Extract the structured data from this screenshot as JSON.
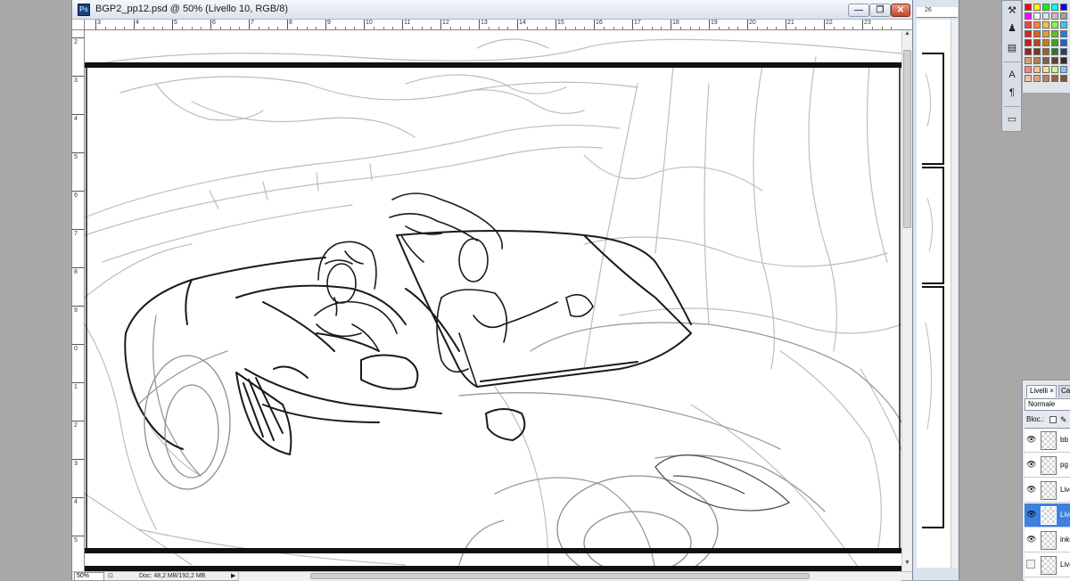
{
  "document": {
    "title": "BGP2_pp12.psd @ 50% (Livello 10, RGB/8)",
    "app_icon": "photoshop-file-icon",
    "zoom": "50%",
    "doc_size": "Doc: 48,2 MB/192,2 MB",
    "ruler_top_labels": [
      "3",
      "4",
      "5",
      "6",
      "7",
      "8",
      "9",
      "10",
      "11",
      "12",
      "13",
      "14",
      "15",
      "16",
      "17",
      "18",
      "19",
      "20",
      "21",
      "22",
      "23"
    ],
    "ruler_left_labels": [
      "2",
      "3",
      "4",
      "5",
      "6",
      "7",
      "8",
      "9",
      "0",
      "1",
      "2",
      "3",
      "4",
      "5"
    ]
  },
  "window_controls": {
    "minimize_glyph": "—",
    "maximize_glyph": "❐",
    "close_glyph": "✕"
  },
  "second_document": {
    "ruler_label": "26"
  },
  "tools": [
    {
      "icon": "hammer-tool-icon",
      "glyph": "⚒"
    },
    {
      "icon": "clone-stamp-icon",
      "glyph": "♟"
    },
    {
      "icon": "brush-preset-icon",
      "glyph": "▤"
    },
    {
      "icon": "character-icon",
      "glyph": "A"
    },
    {
      "icon": "paragraph-icon",
      "glyph": "¶"
    },
    {
      "icon": "notes-icon",
      "glyph": "▭"
    }
  ],
  "swatches": {
    "colors": [
      "#ff0000",
      "#ffff00",
      "#00ff00",
      "#00ffff",
      "#0000ff",
      "#ff00ff",
      "#ffffff",
      "#e0e0e0",
      "#c0c0c0",
      "#a0a0a0",
      "#ff4040",
      "#ff8040",
      "#ffbf40",
      "#80ff40",
      "#40c0ff",
      "#e02020",
      "#e06020",
      "#e0a020",
      "#60c020",
      "#2080e0",
      "#c02020",
      "#c04020",
      "#c08020",
      "#40a020",
      "#2060c0",
      "#a02020",
      "#803020",
      "#a06020",
      "#208020",
      "#204080",
      "#d0a070",
      "#b08050",
      "#806040",
      "#604030",
      "#402820",
      "#ff8080",
      "#ffc080",
      "#ffe080",
      "#c0ff80",
      "#80c0ff",
      "#f0c0a0",
      "#e0a080",
      "#c08060",
      "#a06040",
      "#805030"
    ]
  },
  "layers_panel": {
    "tab_layers": "Livelli",
    "tab_close": "×",
    "tab_channels": "Ca",
    "blend_mode": "Normale",
    "lock_label": "Bloc.:",
    "layers": [
      {
        "name": "bb",
        "visible": true,
        "selected": false
      },
      {
        "name": "pg",
        "visible": true,
        "selected": false
      },
      {
        "name": "Live",
        "visible": true,
        "selected": false
      },
      {
        "name": "Live",
        "visible": true,
        "selected": true
      },
      {
        "name": "inks",
        "visible": true,
        "selected": false
      },
      {
        "name": "Live",
        "visible": false,
        "selected": false
      }
    ]
  }
}
